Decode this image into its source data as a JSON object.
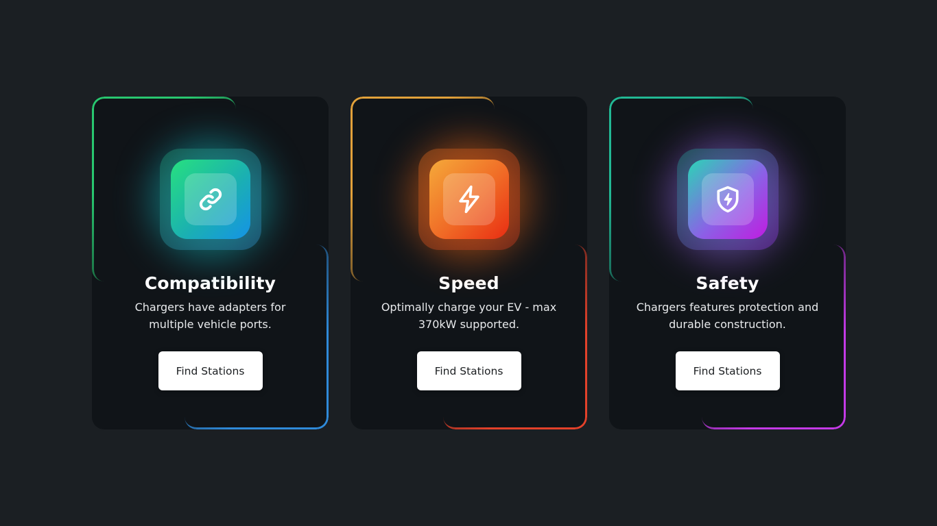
{
  "cards": [
    {
      "title": "Compatibility",
      "description": "Chargers have adapters for multiple vehicle ports.",
      "button_label": "Find Stations",
      "icon": "link-icon",
      "accent_start": "#28c76f",
      "accent_end": "#2f8ad9"
    },
    {
      "title": "Speed",
      "description": "Optimally charge your EV - max 370kW supported.",
      "button_label": "Find Stations",
      "icon": "lightning-bolt-icon",
      "accent_start": "#e2a13a",
      "accent_end": "#e3412a"
    },
    {
      "title": "Safety",
      "description": "Chargers features protection and durable construction.",
      "button_label": "Find Stations",
      "icon": "shield-bolt-icon",
      "accent_start": "#22b894",
      "accent_end": "#c43ae6"
    }
  ]
}
